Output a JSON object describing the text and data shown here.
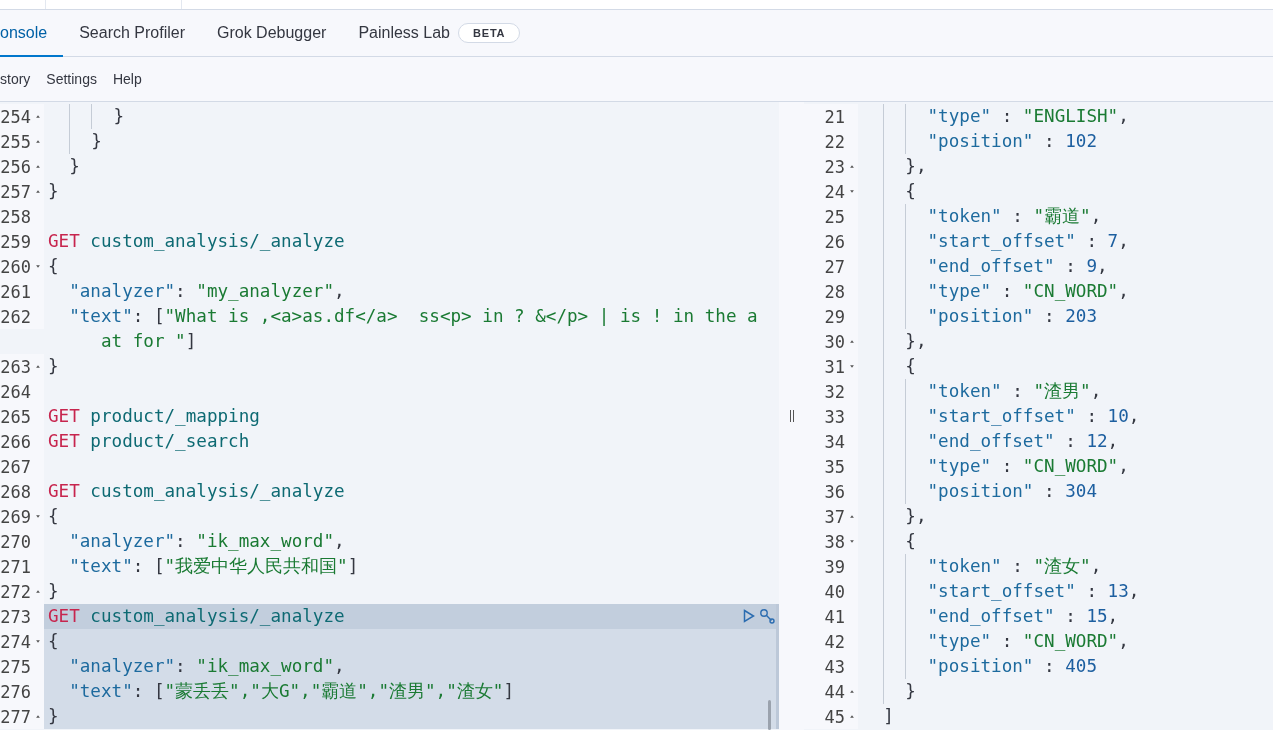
{
  "tabs": [
    {
      "label": "onsole",
      "selected": true
    },
    {
      "label": "Search Profiler",
      "selected": false
    },
    {
      "label": "Grok Debugger",
      "selected": false
    },
    {
      "label": "Painless Lab",
      "selected": false,
      "badge": "BETA"
    }
  ],
  "menu": [
    "story",
    "Settings",
    "Help"
  ],
  "request_editor": {
    "lines": [
      {
        "num": "254",
        "fold_start": false,
        "fold_end": true,
        "selected": false,
        "in_request": false,
        "tokens": [
          {
            "kind": "punct",
            "text": "      }"
          }
        ]
      },
      {
        "num": "255",
        "fold_start": false,
        "fold_end": true,
        "selected": false,
        "in_request": false,
        "tokens": [
          {
            "kind": "punct",
            "text": "    }"
          }
        ]
      },
      {
        "num": "256",
        "fold_start": false,
        "fold_end": true,
        "selected": false,
        "in_request": false,
        "tokens": [
          {
            "kind": "punct",
            "text": "  }"
          }
        ]
      },
      {
        "num": "257",
        "fold_start": false,
        "fold_end": true,
        "selected": false,
        "in_request": false,
        "tokens": [
          {
            "kind": "punct",
            "text": "}"
          }
        ]
      },
      {
        "num": "258",
        "fold_start": false,
        "fold_end": false,
        "selected": false,
        "in_request": false
      },
      {
        "num": "259",
        "fold_start": false,
        "fold_end": false,
        "selected": false,
        "in_request": false,
        "tokens": [
          {
            "kind": "method",
            "text": "GET"
          },
          {
            "kind": "path",
            "text": " custom_analysis/_analyze"
          }
        ]
      },
      {
        "num": "260",
        "fold_start": true,
        "fold_end": false,
        "selected": false,
        "in_request": false,
        "tokens": [
          {
            "kind": "punct",
            "text": "{"
          }
        ]
      },
      {
        "num": "261",
        "fold_start": false,
        "fold_end": false,
        "selected": false,
        "in_request": false,
        "tokens": [
          {
            "kind": "key",
            "text": "  \"analyzer\""
          },
          {
            "kind": "punct",
            "text": ": "
          },
          {
            "kind": "string",
            "text": "\"my_analyzer\""
          },
          {
            "kind": "punct",
            "text": ","
          }
        ]
      },
      {
        "num": "262",
        "fold_start": false,
        "fold_end": false,
        "selected": false,
        "in_request": false,
        "tokens": [
          {
            "kind": "key",
            "text": "  \"text\""
          },
          {
            "kind": "punct",
            "text": ": ["
          },
          {
            "kind": "string",
            "text": "\"What is ,<a>as.df</a>  ss<p> in ? &</p> | is ! in the a"
          }
        ],
        "wrap_tokens": [
          {
            "kind": "string",
            "text": "at for \""
          },
          {
            "kind": "punct",
            "text": "]"
          }
        ]
      },
      {
        "num": "263",
        "fold_start": false,
        "fold_end": true,
        "selected": false,
        "in_request": false,
        "tokens": [
          {
            "kind": "punct",
            "text": "}"
          }
        ]
      },
      {
        "num": "264",
        "fold_start": false,
        "fold_end": false,
        "selected": false,
        "in_request": false
      },
      {
        "num": "265",
        "fold_start": false,
        "fold_end": false,
        "selected": false,
        "in_request": false,
        "tokens": [
          {
            "kind": "method",
            "text": "GET"
          },
          {
            "kind": "path",
            "text": " product/_mapping"
          }
        ]
      },
      {
        "num": "266",
        "fold_start": false,
        "fold_end": false,
        "selected": false,
        "in_request": false,
        "tokens": [
          {
            "kind": "method",
            "text": "GET"
          },
          {
            "kind": "path",
            "text": " product/_search"
          }
        ]
      },
      {
        "num": "267",
        "fold_start": false,
        "fold_end": false,
        "selected": false,
        "in_request": false
      },
      {
        "num": "268",
        "fold_start": false,
        "fold_end": false,
        "selected": false,
        "in_request": false,
        "tokens": [
          {
            "kind": "method",
            "text": "GET"
          },
          {
            "kind": "path",
            "text": " custom_analysis/_analyze"
          }
        ]
      },
      {
        "num": "269",
        "fold_start": true,
        "fold_end": false,
        "selected": false,
        "in_request": false,
        "tokens": [
          {
            "kind": "punct",
            "text": "{"
          }
        ]
      },
      {
        "num": "270",
        "fold_start": false,
        "fold_end": false,
        "selected": false,
        "in_request": false,
        "tokens": [
          {
            "kind": "key",
            "text": "  \"analyzer\""
          },
          {
            "kind": "punct",
            "text": ": "
          },
          {
            "kind": "string",
            "text": "\"ik_max_word\""
          },
          {
            "kind": "punct",
            "text": ","
          }
        ]
      },
      {
        "num": "271",
        "fold_start": false,
        "fold_end": false,
        "selected": false,
        "in_request": false,
        "tokens": [
          {
            "kind": "key",
            "text": "  \"text\""
          },
          {
            "kind": "punct",
            "text": ": ["
          },
          {
            "kind": "string",
            "text": "\"我爱中华人民共和国\""
          },
          {
            "kind": "punct",
            "text": "]"
          }
        ]
      },
      {
        "num": "272",
        "fold_start": false,
        "fold_end": true,
        "selected": false,
        "in_request": false,
        "tokens": [
          {
            "kind": "punct",
            "text": "}"
          }
        ]
      },
      {
        "num": "273",
        "fold_start": false,
        "fold_end": false,
        "selected": true,
        "in_request": true,
        "tokens": [
          {
            "kind": "method",
            "text": "GET"
          },
          {
            "kind": "path",
            "text": " custom_analysis/_analyze"
          }
        ]
      },
      {
        "num": "274",
        "fold_start": true,
        "fold_end": false,
        "selected": false,
        "in_request": true,
        "tokens": [
          {
            "kind": "punct",
            "text": "{"
          }
        ]
      },
      {
        "num": "275",
        "fold_start": false,
        "fold_end": false,
        "selected": false,
        "in_request": true,
        "tokens": [
          {
            "kind": "key",
            "text": "  \"analyzer\""
          },
          {
            "kind": "punct",
            "text": ": "
          },
          {
            "kind": "string",
            "text": "\"ik_max_word\""
          },
          {
            "kind": "punct",
            "text": ","
          }
        ]
      },
      {
        "num": "276",
        "fold_start": false,
        "fold_end": false,
        "selected": false,
        "in_request": true,
        "tokens": [
          {
            "kind": "key",
            "text": "  \"text\""
          },
          {
            "kind": "punct",
            "text": ": ["
          },
          {
            "kind": "string",
            "text": "\"蒙丢丢\",\"大G\",\"霸道\",\"渣男\",\"渣女\""
          },
          {
            "kind": "punct",
            "text": "]"
          }
        ]
      },
      {
        "num": "277",
        "fold_start": false,
        "fold_end": true,
        "selected": false,
        "in_request": true,
        "tokens": [
          {
            "kind": "punct",
            "text": "}"
          }
        ]
      }
    ]
  },
  "response_viewer": {
    "lines": [
      {
        "num": "21",
        "fold_start": false,
        "fold_end": false,
        "tokens": [
          {
            "kind": "key",
            "text": "      \"type\""
          },
          {
            "kind": "punct",
            "text": " : "
          },
          {
            "kind": "string",
            "text": "\"ENGLISH\""
          },
          {
            "kind": "punct",
            "text": ","
          }
        ]
      },
      {
        "num": "22",
        "fold_start": false,
        "fold_end": false,
        "tokens": [
          {
            "kind": "key",
            "text": "      \"position\""
          },
          {
            "kind": "punct",
            "text": " : "
          },
          {
            "kind": "number",
            "text": "102"
          }
        ]
      },
      {
        "num": "23",
        "fold_start": false,
        "fold_end": true,
        "tokens": [
          {
            "kind": "punct",
            "text": "    },"
          }
        ]
      },
      {
        "num": "24",
        "fold_start": true,
        "fold_end": false,
        "tokens": [
          {
            "kind": "punct",
            "text": "    {"
          }
        ]
      },
      {
        "num": "25",
        "fold_start": false,
        "fold_end": false,
        "tokens": [
          {
            "kind": "key",
            "text": "      \"token\""
          },
          {
            "kind": "punct",
            "text": " : "
          },
          {
            "kind": "string",
            "text": "\"霸道\""
          },
          {
            "kind": "punct",
            "text": ","
          }
        ]
      },
      {
        "num": "26",
        "fold_start": false,
        "fold_end": false,
        "tokens": [
          {
            "kind": "key",
            "text": "      \"start_offset\""
          },
          {
            "kind": "punct",
            "text": " : "
          },
          {
            "kind": "number",
            "text": "7"
          },
          {
            "kind": "punct",
            "text": ","
          }
        ]
      },
      {
        "num": "27",
        "fold_start": false,
        "fold_end": false,
        "tokens": [
          {
            "kind": "key",
            "text": "      \"end_offset\""
          },
          {
            "kind": "punct",
            "text": " : "
          },
          {
            "kind": "number",
            "text": "9"
          },
          {
            "kind": "punct",
            "text": ","
          }
        ]
      },
      {
        "num": "28",
        "fold_start": false,
        "fold_end": false,
        "tokens": [
          {
            "kind": "key",
            "text": "      \"type\""
          },
          {
            "kind": "punct",
            "text": " : "
          },
          {
            "kind": "string",
            "text": "\"CN_WORD\""
          },
          {
            "kind": "punct",
            "text": ","
          }
        ]
      },
      {
        "num": "29",
        "fold_start": false,
        "fold_end": false,
        "tokens": [
          {
            "kind": "key",
            "text": "      \"position\""
          },
          {
            "kind": "punct",
            "text": " : "
          },
          {
            "kind": "number",
            "text": "203"
          }
        ]
      },
      {
        "num": "30",
        "fold_start": false,
        "fold_end": true,
        "tokens": [
          {
            "kind": "punct",
            "text": "    },"
          }
        ]
      },
      {
        "num": "31",
        "fold_start": true,
        "fold_end": false,
        "tokens": [
          {
            "kind": "punct",
            "text": "    {"
          }
        ]
      },
      {
        "num": "32",
        "fold_start": false,
        "fold_end": false,
        "tokens": [
          {
            "kind": "key",
            "text": "      \"token\""
          },
          {
            "kind": "punct",
            "text": " : "
          },
          {
            "kind": "string",
            "text": "\"渣男\""
          },
          {
            "kind": "punct",
            "text": ","
          }
        ]
      },
      {
        "num": "33",
        "fold_start": false,
        "fold_end": false,
        "tokens": [
          {
            "kind": "key",
            "text": "      \"start_offset\""
          },
          {
            "kind": "punct",
            "text": " : "
          },
          {
            "kind": "number",
            "text": "10"
          },
          {
            "kind": "punct",
            "text": ","
          }
        ]
      },
      {
        "num": "34",
        "fold_start": false,
        "fold_end": false,
        "tokens": [
          {
            "kind": "key",
            "text": "      \"end_offset\""
          },
          {
            "kind": "punct",
            "text": " : "
          },
          {
            "kind": "number",
            "text": "12"
          },
          {
            "kind": "punct",
            "text": ","
          }
        ]
      },
      {
        "num": "35",
        "fold_start": false,
        "fold_end": false,
        "tokens": [
          {
            "kind": "key",
            "text": "      \"type\""
          },
          {
            "kind": "punct",
            "text": " : "
          },
          {
            "kind": "string",
            "text": "\"CN_WORD\""
          },
          {
            "kind": "punct",
            "text": ","
          }
        ]
      },
      {
        "num": "36",
        "fold_start": false,
        "fold_end": false,
        "tokens": [
          {
            "kind": "key",
            "text": "      \"position\""
          },
          {
            "kind": "punct",
            "text": " : "
          },
          {
            "kind": "number",
            "text": "304"
          }
        ]
      },
      {
        "num": "37",
        "fold_start": false,
        "fold_end": true,
        "tokens": [
          {
            "kind": "punct",
            "text": "    },"
          }
        ]
      },
      {
        "num": "38",
        "fold_start": true,
        "fold_end": false,
        "tokens": [
          {
            "kind": "punct",
            "text": "    {"
          }
        ]
      },
      {
        "num": "39",
        "fold_start": false,
        "fold_end": false,
        "tokens": [
          {
            "kind": "key",
            "text": "      \"token\""
          },
          {
            "kind": "punct",
            "text": " : "
          },
          {
            "kind": "string",
            "text": "\"渣女\""
          },
          {
            "kind": "punct",
            "text": ","
          }
        ]
      },
      {
        "num": "40",
        "fold_start": false,
        "fold_end": false,
        "tokens": [
          {
            "kind": "key",
            "text": "      \"start_offset\""
          },
          {
            "kind": "punct",
            "text": " : "
          },
          {
            "kind": "number",
            "text": "13"
          },
          {
            "kind": "punct",
            "text": ","
          }
        ]
      },
      {
        "num": "41",
        "fold_start": false,
        "fold_end": false,
        "tokens": [
          {
            "kind": "key",
            "text": "      \"end_offset\""
          },
          {
            "kind": "punct",
            "text": " : "
          },
          {
            "kind": "number",
            "text": "15"
          },
          {
            "kind": "punct",
            "text": ","
          }
        ]
      },
      {
        "num": "42",
        "fold_start": false,
        "fold_end": false,
        "tokens": [
          {
            "kind": "key",
            "text": "      \"type\""
          },
          {
            "kind": "punct",
            "text": " : "
          },
          {
            "kind": "string",
            "text": "\"CN_WORD\""
          },
          {
            "kind": "punct",
            "text": ","
          }
        ]
      },
      {
        "num": "43",
        "fold_start": false,
        "fold_end": false,
        "tokens": [
          {
            "kind": "key",
            "text": "      \"position\""
          },
          {
            "kind": "punct",
            "text": " : "
          },
          {
            "kind": "number",
            "text": "405"
          }
        ]
      },
      {
        "num": "44",
        "fold_start": false,
        "fold_end": true,
        "tokens": [
          {
            "kind": "punct",
            "text": "    }"
          }
        ]
      },
      {
        "num": "45",
        "fold_start": false,
        "fold_end": true,
        "tokens": [
          {
            "kind": "punct",
            "text": "  ]"
          }
        ]
      }
    ]
  }
}
